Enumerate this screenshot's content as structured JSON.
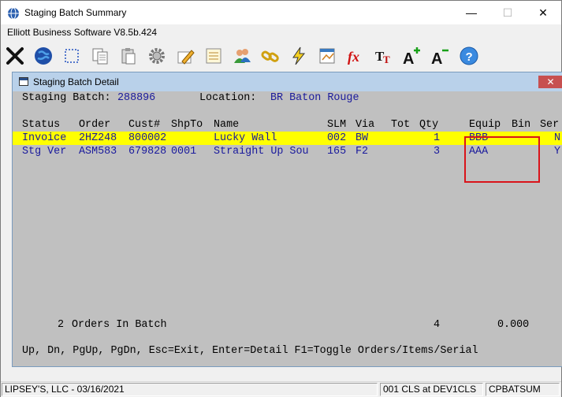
{
  "window": {
    "title": "Staging Batch Summary",
    "subtitle": "Elliott Business Software V8.5b.424",
    "minimize_glyph": "—",
    "maximize_glyph": "☐",
    "close_glyph": "✕"
  },
  "toolbar": {
    "buttons": [
      "close-x-icon",
      "globe-icon",
      "select-icon",
      "copy-icon",
      "paste-icon",
      "settings-gear-icon",
      "edit-pencil-icon",
      "notes-icon",
      "users-icon",
      "chain-link-icon",
      "lightning-icon",
      "report-icon",
      "function-fx-icon",
      "font-size-icon",
      "increase-font-icon",
      "decrease-font-icon",
      "help-icon"
    ]
  },
  "detail": {
    "title": "Staging Batch Detail",
    "close_glyph": "✕",
    "staging_batch_label": "Staging Batch:",
    "staging_batch_value": "288896",
    "location_label": "Location:",
    "location_value": "BR Baton Rouge",
    "headers": {
      "status": "Status",
      "order": "Order",
      "cust": "Cust#",
      "shipto": "ShpTo",
      "name": "Name",
      "slm": "SLM",
      "via": "Via",
      "tot": "Tot",
      "qty": "Qty",
      "equip": "Equip",
      "bin": "Bin",
      "ser": "Ser"
    },
    "rows": [
      {
        "status": "Invoice",
        "order": "2HZ248",
        "cust": "800002",
        "shipto": "",
        "name": "Lucky Wall",
        "slm": "002",
        "via": "BW",
        "qty": "1",
        "equip": "BBB",
        "bin": "",
        "ser": "N"
      },
      {
        "status": "Stg Ver",
        "order": "ASM583",
        "cust": "679828",
        "shipto": "0001",
        "name": "Straight Up Sou",
        "slm": "165",
        "via": "F2",
        "qty": "3",
        "equip": "AAA",
        "bin": "",
        "ser": "Y"
      }
    ],
    "summary": {
      "count": "2",
      "label": "Orders In Batch",
      "qty_total": "4",
      "amount": "0.000"
    },
    "help_line": "Up, Dn, PgUp, PgDn, Esc=Exit, Enter=Detail F1=Toggle Orders/Items/Serial",
    "colors": {
      "highlight": "#ffff00",
      "value_text": "#1a1a9c",
      "marker_box": "#d9141a"
    }
  },
  "statusbar": {
    "company": "LIPSEY'S, LLC - 03/16/2021",
    "session": "001 CLS at DEV1CLS",
    "program": "CPBATSUM"
  }
}
